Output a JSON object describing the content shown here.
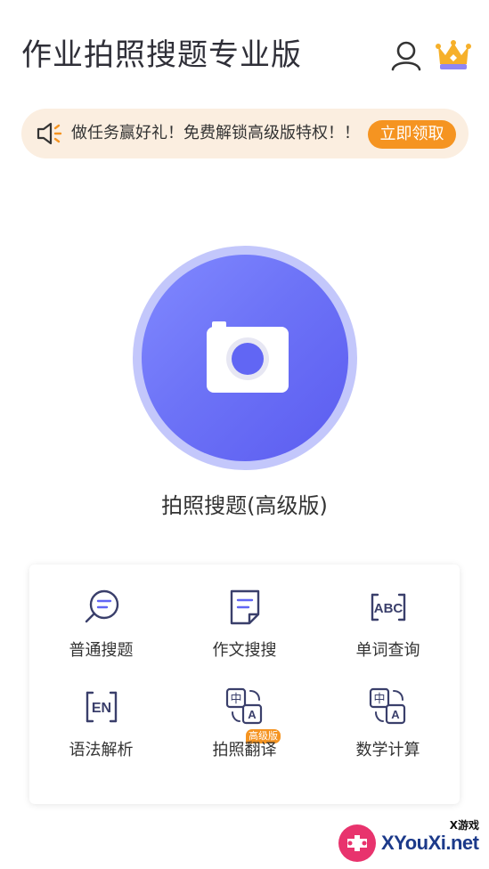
{
  "header": {
    "title": "作业拍照搜题专业版",
    "user_icon": "user-icon",
    "vip_icon": "crown-icon"
  },
  "banner": {
    "icon": "speaker-icon",
    "text": "做任务赢好礼！免费解锁高级版特权！！",
    "button_label": "立即领取",
    "accent_color": "#f59421"
  },
  "camera": {
    "icon": "camera-icon",
    "label": "拍照搜题(高级版)",
    "color": "#6166f4"
  },
  "tools": [
    {
      "icon": "chat-search-icon",
      "label": "普通搜题"
    },
    {
      "icon": "document-icon",
      "label": "作文搜搜"
    },
    {
      "icon": "abc-icon",
      "label": "单词查询"
    },
    {
      "icon": "en-icon",
      "label": "语法解析"
    },
    {
      "icon": "translate-icon",
      "label": "拍照翻译",
      "badge": "高级版"
    },
    {
      "icon": "translate-icon",
      "label": "数学计算"
    }
  ],
  "watermark": {
    "small_text": "X游戏",
    "brand": "XYouXi.net"
  }
}
